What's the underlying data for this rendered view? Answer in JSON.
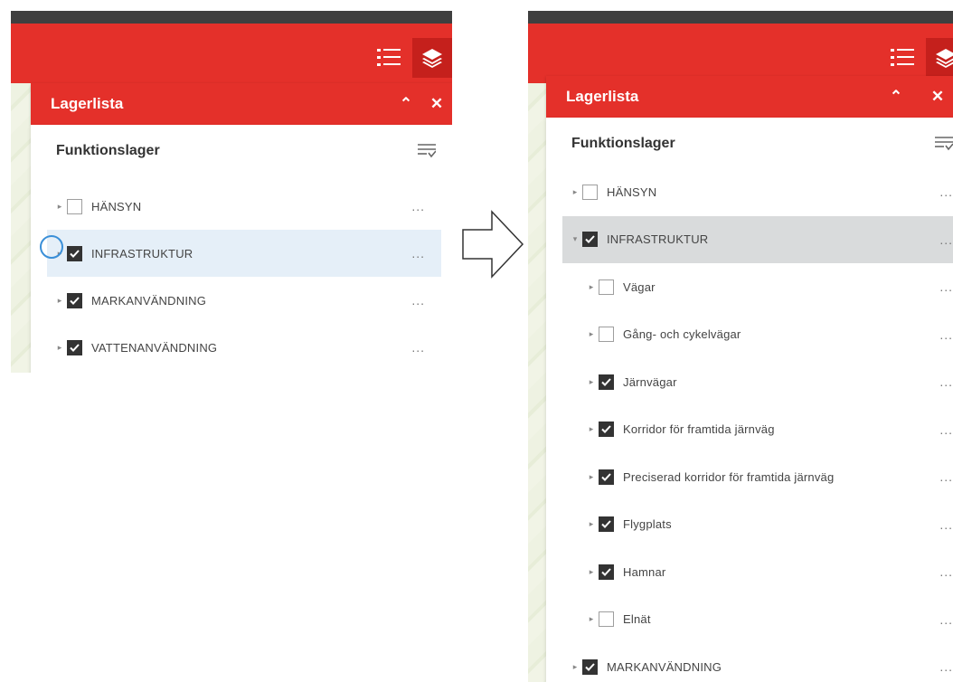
{
  "panel": {
    "title": "Lagerlista",
    "collapse_icon": "double-chevron-up-icon",
    "close_icon": "close-icon",
    "section_title": "Funktionslager",
    "filter_icon": "filter-list-icon"
  },
  "toolbar": {
    "layer_list_icon": "layer-list-icon",
    "layers_icon": "layers-icon"
  },
  "left_layers": [
    {
      "label": "HÄNSYN",
      "checked": false
    },
    {
      "label": "INFRASTRUKTUR",
      "checked": true
    },
    {
      "label": "MARKANVÄNDNING",
      "checked": true
    },
    {
      "label": "VATTENANVÄNDNING",
      "checked": true
    }
  ],
  "right_layers": [
    {
      "label": "HÄNSYN",
      "checked": false,
      "level": 0
    },
    {
      "label": "INFRASTRUKTUR",
      "checked": true,
      "level": 0,
      "expanded": true
    },
    {
      "label": "Vägar",
      "checked": false,
      "level": 1
    },
    {
      "label": "Gång- och cykelvägar",
      "checked": false,
      "level": 1
    },
    {
      "label": "Järnvägar",
      "checked": true,
      "level": 1
    },
    {
      "label": "Korridor för framtida järnväg",
      "checked": true,
      "level": 1
    },
    {
      "label": "Preciserad korridor för framtida järnväg",
      "checked": true,
      "level": 1
    },
    {
      "label": "Flygplats",
      "checked": true,
      "level": 1
    },
    {
      "label": "Hamnar",
      "checked": true,
      "level": 1
    },
    {
      "label": "Elnät",
      "checked": false,
      "level": 1
    },
    {
      "label": "MARKANVÄNDNING",
      "checked": true,
      "level": 0
    }
  ],
  "more_label": "...",
  "transition_icon": "arrow-right-icon",
  "colors": {
    "brand_red": "#e4302a",
    "dark_bar": "#3f3f3f",
    "checked": "#333333"
  }
}
